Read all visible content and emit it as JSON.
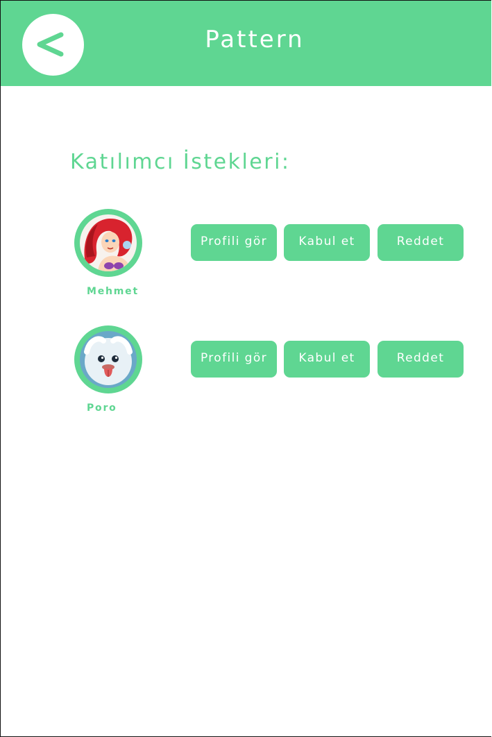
{
  "header": {
    "title": "Pattern",
    "back_icon": "chevron-left-icon"
  },
  "section": {
    "title": "Katılımcı İstekleri:"
  },
  "colors": {
    "accent": "#5fd692",
    "text_on_accent": "#ffffff",
    "background": "#ffffff"
  },
  "requests": [
    {
      "name": "Mehmet",
      "avatar_icon": "mermaid-avatar-icon",
      "view_profile_label": "Profili gör",
      "accept_label": "Kabul et",
      "reject_label": "Reddet"
    },
    {
      "name": "Poro",
      "avatar_icon": "poro-avatar-icon",
      "view_profile_label": "Profili gör",
      "accept_label": "Kabul et",
      "reject_label": "Reddet"
    }
  ]
}
